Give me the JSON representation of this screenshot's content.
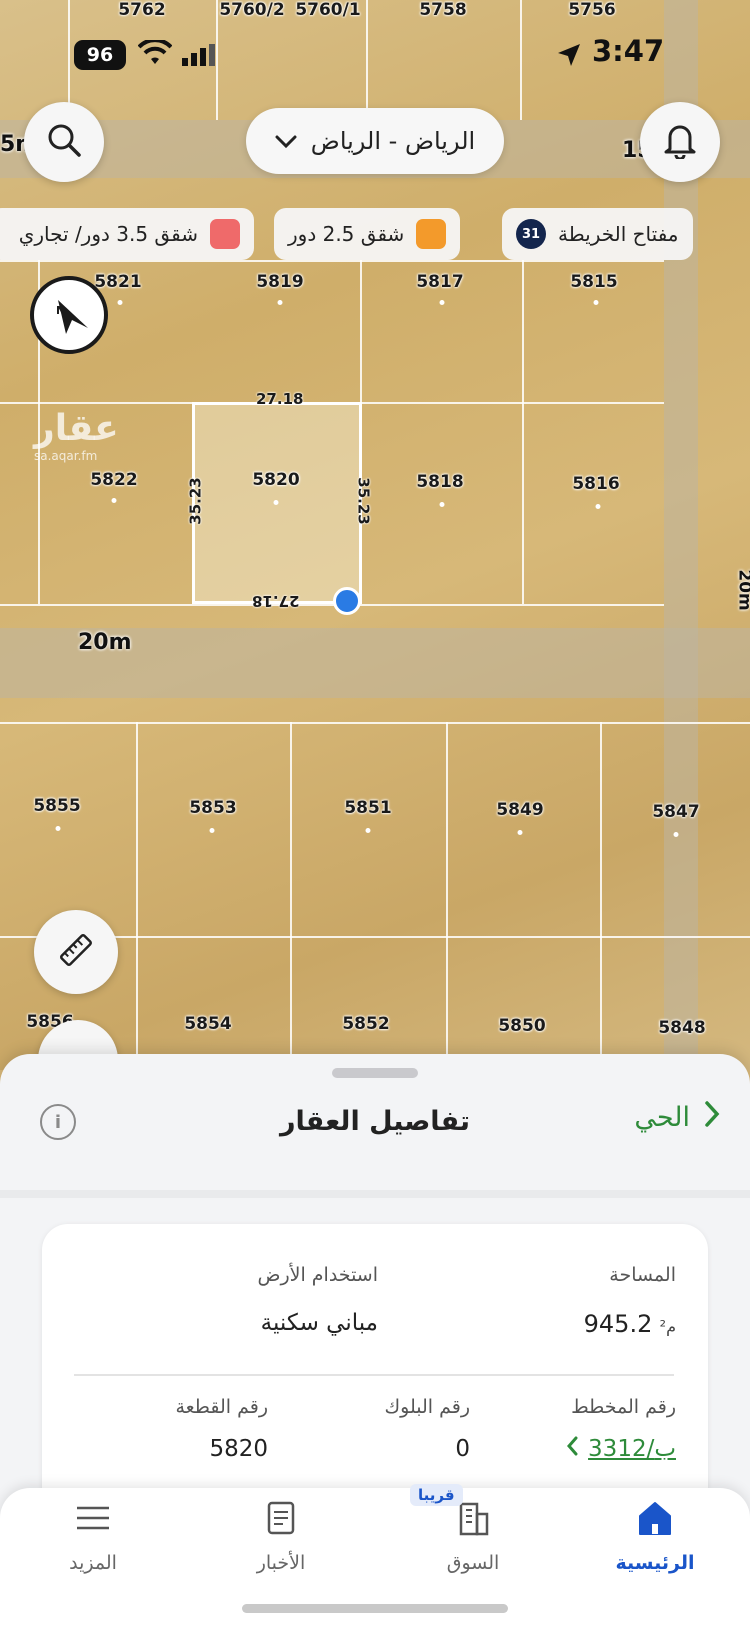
{
  "status_bar": {
    "battery": "96",
    "time": "3:47"
  },
  "map": {
    "city_selector": "الرياض - الرياض",
    "legend": [
      {
        "label": "مفتاح الخريطة",
        "badge": "31",
        "color": "#14264d"
      },
      {
        "label": "شقق 2.5 دور",
        "color": "#f39a2b"
      },
      {
        "label": "شقق 3.5 دور/ تجاري",
        "color": "#ef6a6a"
      }
    ],
    "watermark": {
      "logo": "عقار",
      "site": "sa.aqar.fm"
    },
    "street_labels": {
      "top_left": "5m",
      "top_right": "15m",
      "middle": "20m",
      "right_edge": "20m"
    },
    "top_lots": [
      "5762",
      "5760/2",
      "5760/1",
      "5758",
      "5756"
    ],
    "row1_lots": [
      "5821",
      "5819",
      "5817",
      "5815"
    ],
    "row2_lots": [
      "5822",
      "5820",
      "5818",
      "5816"
    ],
    "row3_lots": [
      "5855",
      "5853",
      "5851",
      "5849",
      "5847"
    ],
    "row4_lots": [
      "5856",
      "5854",
      "5852",
      "5850",
      "5848"
    ],
    "selected_lot_dims": {
      "top": "27.18",
      "bottom": "27.18",
      "left": "35.23",
      "right": "35.23"
    }
  },
  "sheet": {
    "title": "تفاصيل العقار",
    "district_link": "الحي",
    "info_icon": "i",
    "fields": {
      "area_label": "المساحة",
      "area_value": "945.2",
      "area_unit": "م²",
      "land_use_label": "استخدام الأرض",
      "land_use_value": "مباني سكنية",
      "plan_label": "رقم المخطط",
      "plan_value": "3312/ب",
      "block_label": "رقم البلوك",
      "block_value": "0",
      "plot_label": "رقم القطعة",
      "plot_value": "5820"
    }
  },
  "tabbar": {
    "tabs": [
      {
        "label": "الرئيسية",
        "icon": "home-icon",
        "active": true
      },
      {
        "label": "السوق",
        "icon": "building-icon",
        "active": false,
        "tag": "قريبا"
      },
      {
        "label": "الأخبار",
        "icon": "news-icon",
        "active": false
      },
      {
        "label": "المزيد",
        "icon": "menu-icon",
        "active": false
      }
    ]
  }
}
